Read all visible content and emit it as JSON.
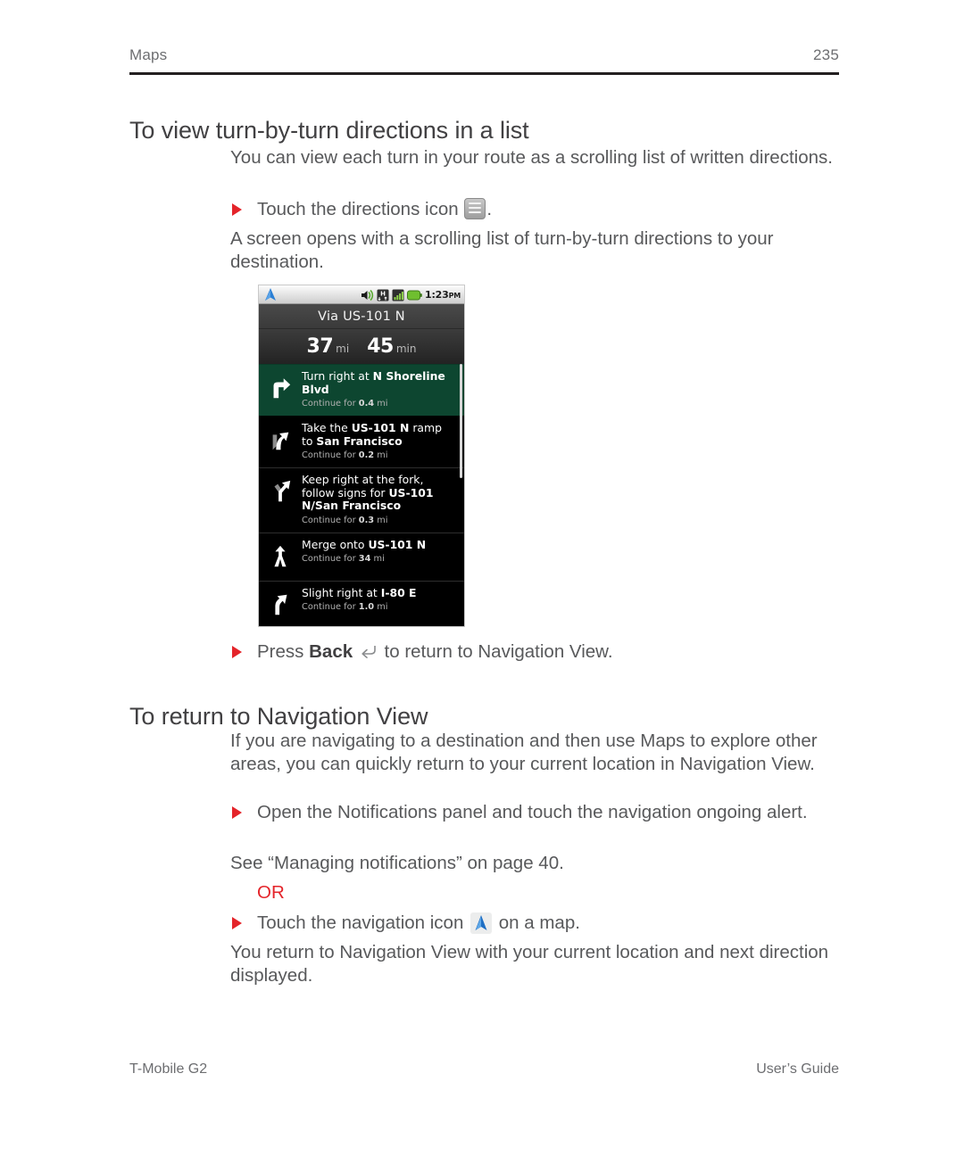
{
  "header": {
    "left": "Maps",
    "page_number": "235"
  },
  "footer": {
    "left": "T-Mobile G2",
    "right": "User’s Guide"
  },
  "sections": [
    {
      "heading": "To view turn-by-turn directions in a list",
      "intro": "You can view each turn in your route as a scrolling list of written directions.",
      "bullet1_pre": "Touch the directions icon",
      "bullet1_post": ".",
      "bullet1_detail": "A screen opens with a scrolling list of turn-by-turn directions to your destination.",
      "bullet2_pre": "Press",
      "bullet2_bold": "Back",
      "bullet2_post": "to return to Navigation View."
    },
    {
      "heading": "To return to Navigation View",
      "intro": "If you are navigating to a destination and then use Maps to explore other areas, you can quickly return to your current location in Navigation View.",
      "bullet1": "Open the Notifications panel and touch the navigation ongoing alert.",
      "see_also": "See “Managing notifications” on page 40.",
      "or_label": "OR",
      "bullet2_pre": "Touch the navigation icon",
      "bullet2_post": "on a map.",
      "bullet2_detail": "You return to Navigation View with your current location and next direction displayed."
    }
  ],
  "icons": {
    "directions": "directions-list-icon",
    "navigation": "navigation-arrow-icon",
    "back": "back-arrow-icon"
  },
  "phone_screenshot": {
    "status_bar": {
      "nav_icon": "navigation-arrow-icon",
      "sound_icon": "sound-vibrate-icon",
      "data_icon": "hspa-h-icon",
      "signal_icon": "signal-bars-icon",
      "battery_icon": "battery-icon",
      "clock": "1:23",
      "ampm": "PM"
    },
    "via": "Via US-101 N",
    "summary": {
      "distance_value": "37",
      "distance_unit": "mi",
      "time_value": "45",
      "time_unit": "min"
    },
    "steps": [
      {
        "icon": "turn-right-icon",
        "current": true,
        "parts": [
          {
            "t": "Turn right at ",
            "b": false
          },
          {
            "t": "N Shoreline Blvd",
            "b": true
          }
        ],
        "sub_pre": "Continue for ",
        "sub_bold": "0.4",
        "sub_post": " mi"
      },
      {
        "icon": "ramp-right-icon",
        "current": false,
        "parts": [
          {
            "t": "Take the ",
            "b": false
          },
          {
            "t": "US-101 N",
            "b": true
          },
          {
            "t": " ramp to ",
            "b": false
          },
          {
            "t": "San Francisco",
            "b": true
          }
        ],
        "sub_pre": "Continue for ",
        "sub_bold": "0.2",
        "sub_post": " mi"
      },
      {
        "icon": "fork-keep-right-icon",
        "current": false,
        "parts": [
          {
            "t": "Keep right at the fork, follow signs for ",
            "b": false
          },
          {
            "t": "US-101 N/San Francisco",
            "b": true
          }
        ],
        "sub_pre": "Continue for ",
        "sub_bold": "0.3",
        "sub_post": " mi"
      },
      {
        "icon": "merge-icon",
        "current": false,
        "parts": [
          {
            "t": "Merge onto ",
            "b": false
          },
          {
            "t": "US-101 N",
            "b": true
          }
        ],
        "sub_pre": "Continue for ",
        "sub_bold": "34",
        "sub_post": " mi"
      },
      {
        "icon": "slight-right-icon",
        "current": false,
        "parts": [
          {
            "t": "Slight right at ",
            "b": false
          },
          {
            "t": "I-80 E",
            "b": true
          }
        ],
        "sub_pre": "Continue for ",
        "sub_bold": "1.0",
        "sub_post": " mi"
      }
    ]
  },
  "colors": {
    "bullet_red": "#e4242a",
    "current_step_green": "#0d4630",
    "nav_blue": "#2b7fd4",
    "text_gray": "#58595b"
  }
}
